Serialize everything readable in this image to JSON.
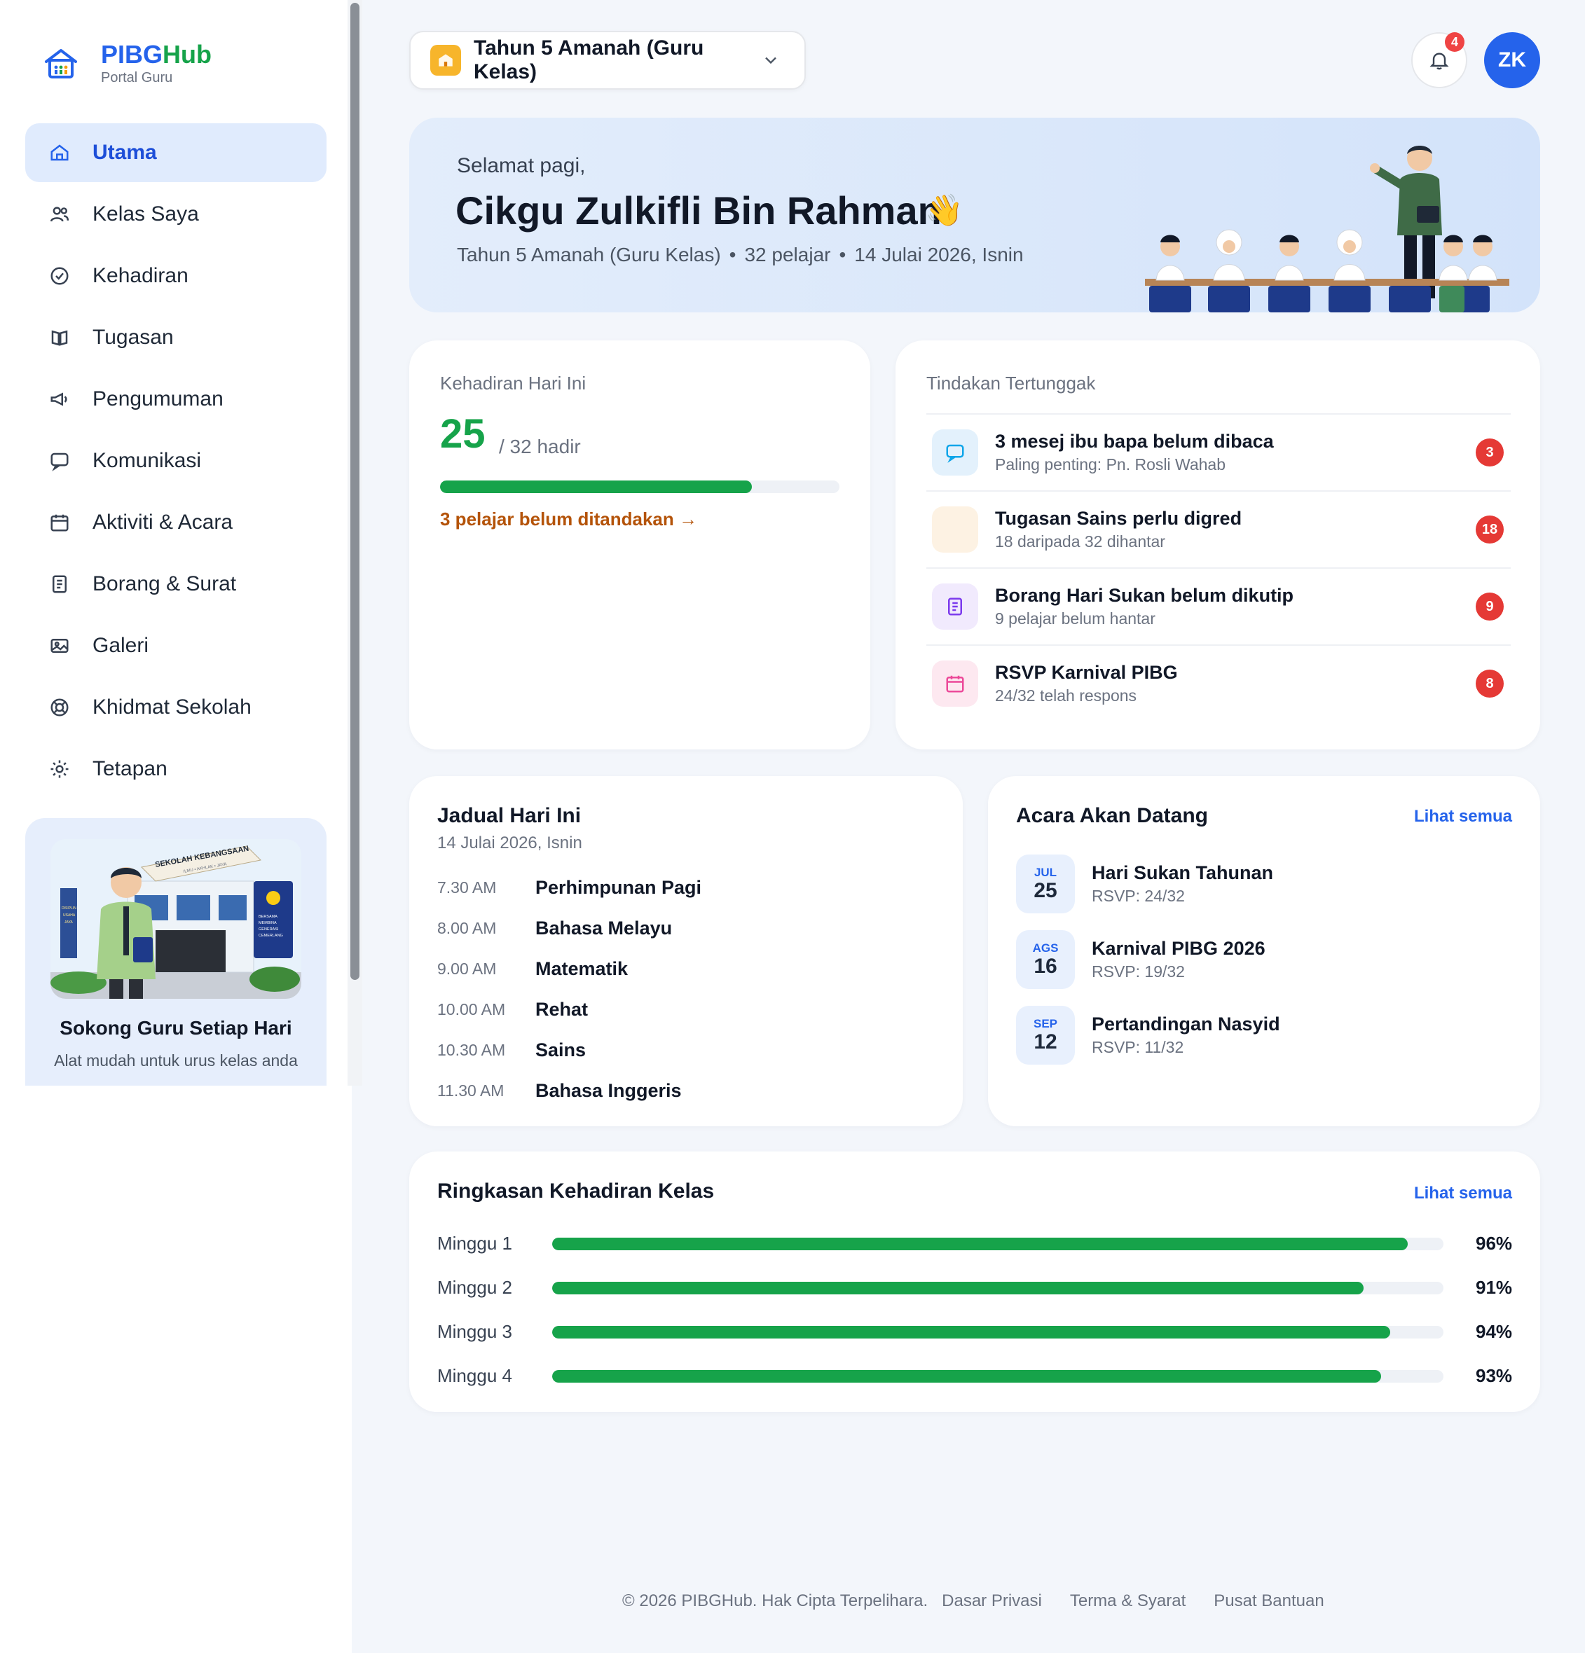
{
  "brand": {
    "name_part1": "PIBG",
    "name_part2": "Hub",
    "subtitle": "Portal Guru"
  },
  "sidebar": {
    "items": [
      {
        "label": "Utama",
        "icon": "home-icon",
        "active": true
      },
      {
        "label": "Kelas Saya",
        "icon": "users-icon"
      },
      {
        "label": "Kehadiran",
        "icon": "check-circle-icon"
      },
      {
        "label": "Tugasan",
        "icon": "book-icon"
      },
      {
        "label": "Pengumuman",
        "icon": "megaphone-icon"
      },
      {
        "label": "Komunikasi",
        "icon": "chat-icon"
      },
      {
        "label": "Aktiviti & Acara",
        "icon": "calendar-icon"
      },
      {
        "label": "Borang & Surat",
        "icon": "document-icon"
      },
      {
        "label": "Galeri",
        "icon": "image-icon"
      },
      {
        "label": "Khidmat Sekolah",
        "icon": "lifebuoy-icon"
      },
      {
        "label": "Tetapan",
        "icon": "settings-icon"
      }
    ],
    "promo": {
      "title": "Sokong Guru Setiap Hari",
      "subtitle": "Alat mudah untuk urus kelas anda",
      "sign_text": "SEKOLAH KEBANGSAAN",
      "sign_motto": "ILMU • AKHLAK • JAYA",
      "banner_left": "DISIPLIN USAHA JAYA",
      "banner_right": "BERSAMA MEMBINA GENERASI CEMERLANG"
    }
  },
  "header": {
    "class_selector": "Tahun 5 Amanah (Guru Kelas)",
    "notification_count": "4",
    "avatar_initials": "ZK"
  },
  "hero": {
    "greeting": "Selamat pagi,",
    "name": "Cikgu Zulkifli Bin Rahman",
    "wave": "👋",
    "class_info": "Tahun 5 Amanah (Guru Kelas)",
    "students": "32 pelajar",
    "date": "14 Julai 2026, Isnin"
  },
  "attendance": {
    "label": "Kehadiran Hari Ini",
    "present": "25",
    "total_text": "/ 32 hadir",
    "fraction": 0.78,
    "warning": "3 pelajar belum ditandakan →"
  },
  "pending": {
    "label": "Tindakan Tertunggak",
    "items": [
      {
        "title": "3 mesej ibu bapa belum dibaca",
        "sub": "Paling penting: Pn. Rosli Wahab",
        "count": "3",
        "icon": "chat-icon",
        "bg": "#e3f1fc",
        "color": "#0ea5e9"
      },
      {
        "title": "Tugasan Sains perlu digred",
        "sub": "18 daripada 32 dihantar",
        "count": "18",
        "icon": "blank-icon",
        "bg": "#fdf2e3",
        "color": "#f59e0b"
      },
      {
        "title": "Borang Hari Sukan belum dikutip",
        "sub": "9 pelajar belum hantar",
        "count": "9",
        "icon": "document-icon",
        "bg": "#f1eafd",
        "color": "#7c3aed"
      },
      {
        "title": "RSVP Karnival PIBG",
        "sub": "24/32 telah respons",
        "count": "8",
        "icon": "calendar-icon",
        "bg": "#fde8f0",
        "color": "#ec4899"
      }
    ]
  },
  "schedule": {
    "title": "Jadual Hari Ini",
    "date": "14 Julai 2026, Isnin",
    "items": [
      {
        "time": "7.30 AM",
        "subject": "Perhimpunan Pagi"
      },
      {
        "time": "8.00 AM",
        "subject": "Bahasa Melayu"
      },
      {
        "time": "9.00 AM",
        "subject": "Matematik"
      },
      {
        "time": "10.00 AM",
        "subject": "Rehat"
      },
      {
        "time": "10.30 AM",
        "subject": "Sains"
      },
      {
        "time": "11.30 AM",
        "subject": "Bahasa Inggeris"
      }
    ]
  },
  "events": {
    "title": "Acara Akan Datang",
    "see_all": "Lihat semua",
    "items": [
      {
        "month": "JUL",
        "day": "25",
        "title": "Hari Sukan Tahunan",
        "rsvp": "RSVP: 24/32"
      },
      {
        "month": "AGS",
        "day": "16",
        "title": "Karnival PIBG 2026",
        "rsvp": "RSVP: 19/32"
      },
      {
        "month": "SEP",
        "day": "12",
        "title": "Pertandingan Nasyid",
        "rsvp": "RSVP: 11/32"
      }
    ]
  },
  "summary": {
    "title": "Ringkasan Kehadiran Kelas",
    "see_all": "Lihat semua",
    "rows": [
      {
        "label": "Minggu 1",
        "pct": "96%",
        "value": 0.96
      },
      {
        "label": "Minggu 2",
        "pct": "91%",
        "value": 0.91
      },
      {
        "label": "Minggu 3",
        "pct": "94%",
        "value": 0.94
      },
      {
        "label": "Minggu 4",
        "pct": "93%",
        "value": 0.93
      }
    ]
  },
  "footer": {
    "copyright": "© 2026 PIBGHub. Hak Cipta Terpelihara.",
    "privacy": "Dasar Privasi",
    "terms": "Terma & Syarat",
    "help": "Pusat Bantuan"
  },
  "colors": {
    "primary": "#2563eb",
    "success": "#16a34a",
    "danger": "#e53935",
    "warning": "#b45309"
  }
}
